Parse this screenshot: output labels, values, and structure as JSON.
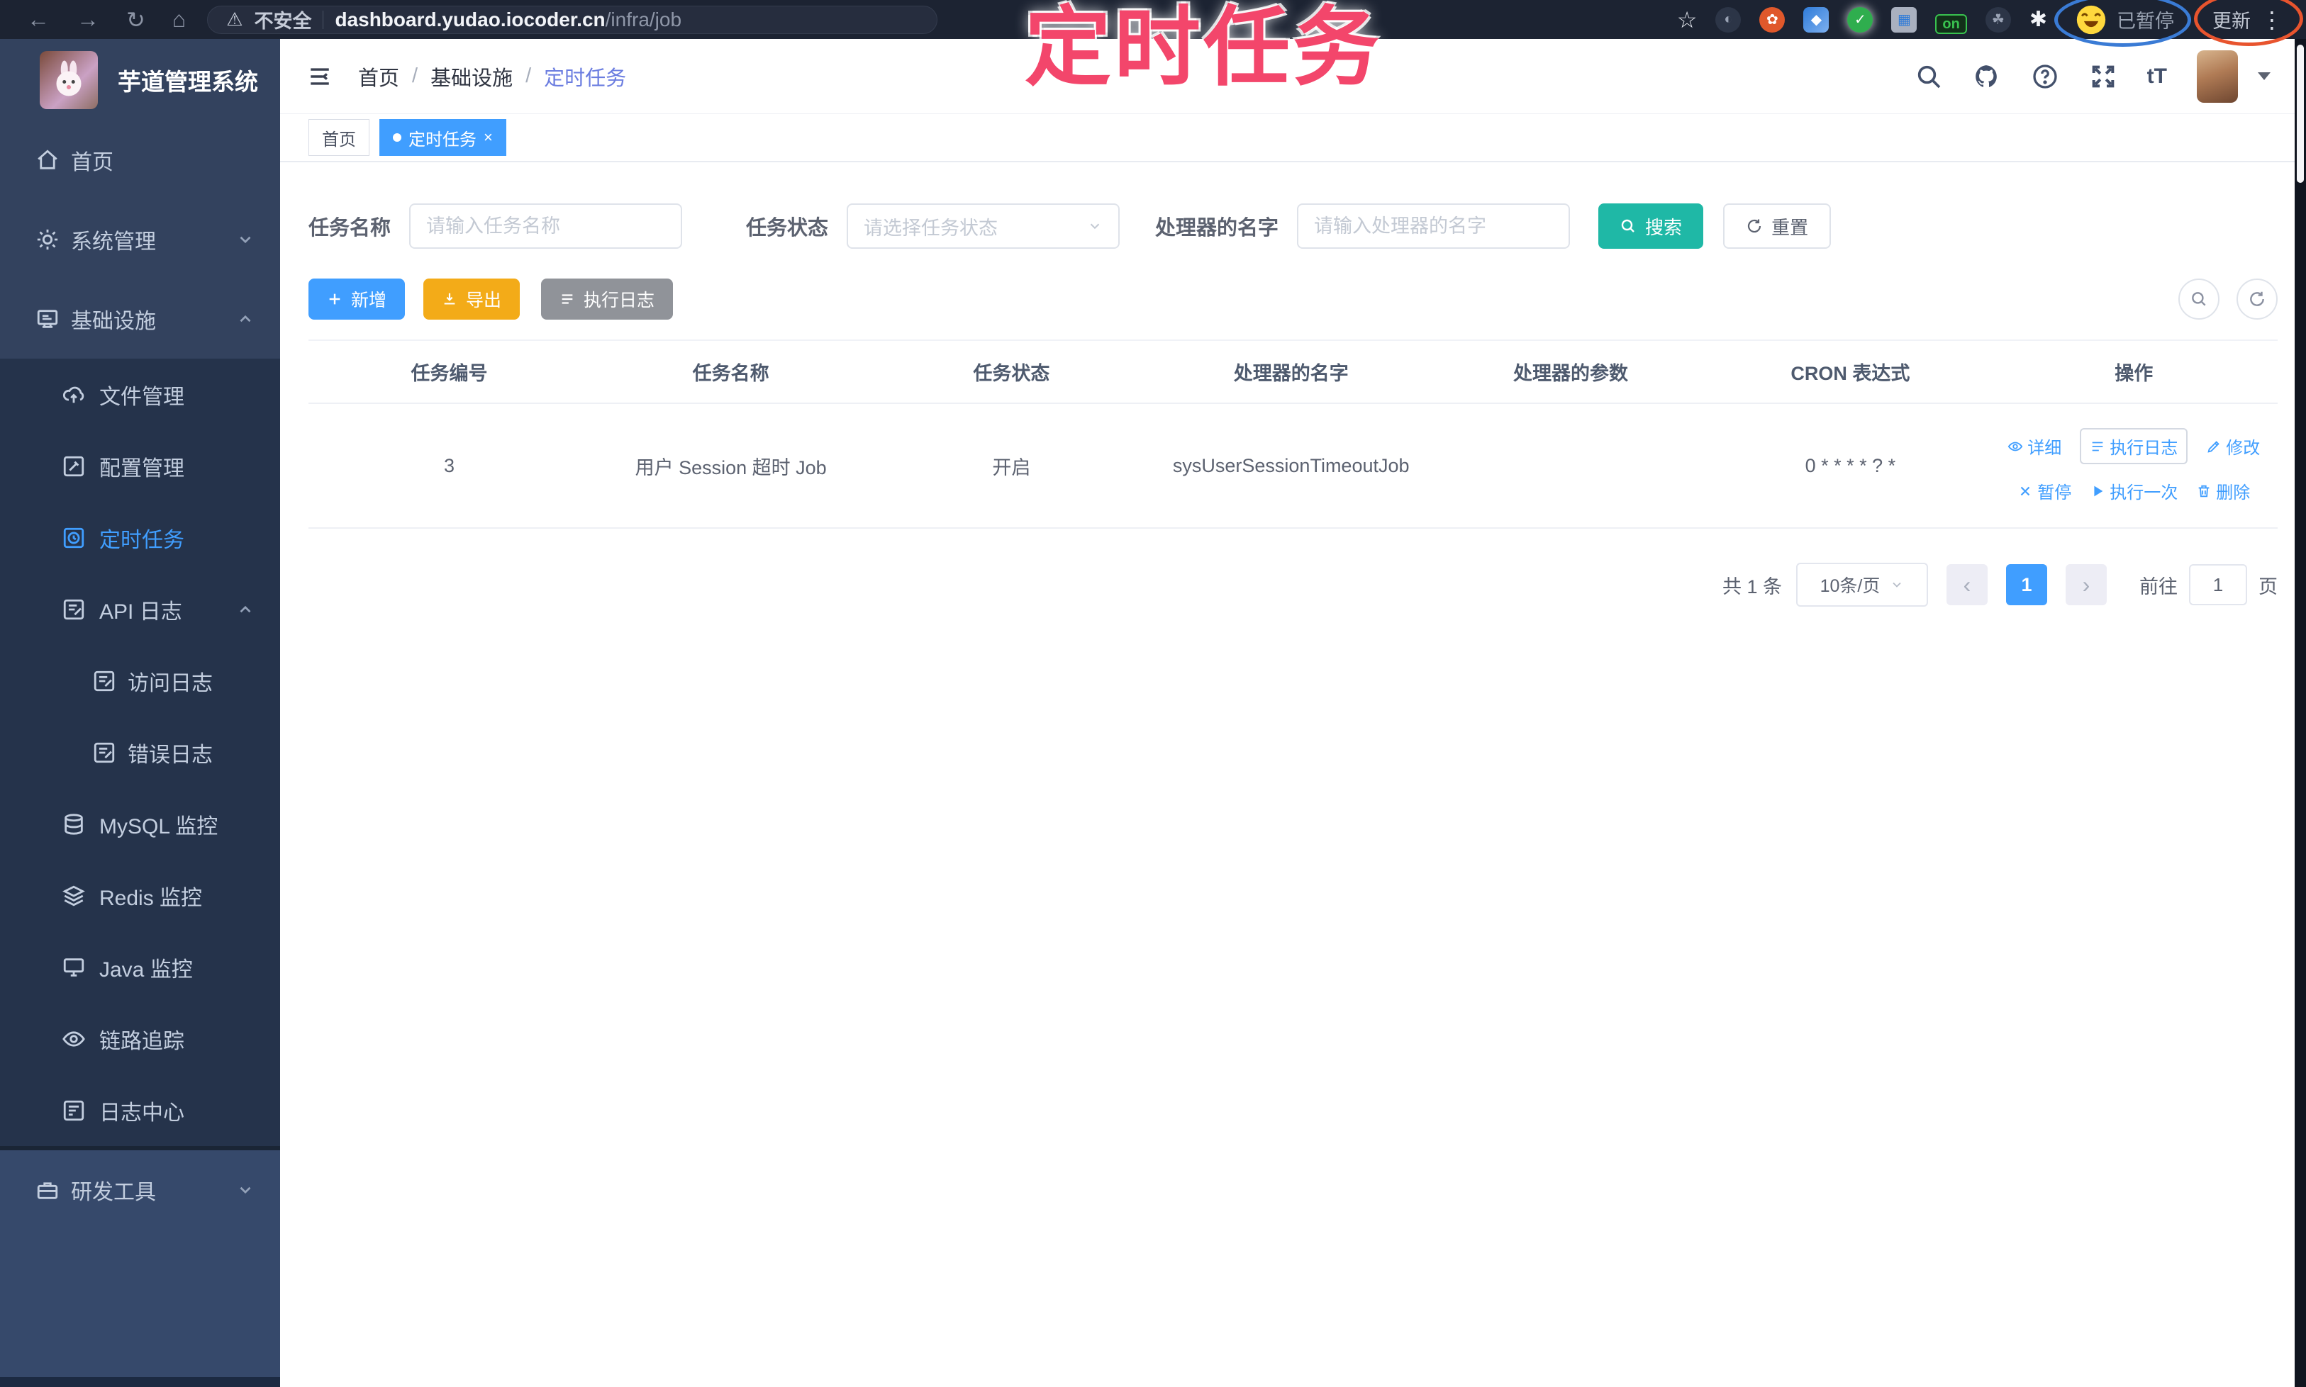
{
  "colors": {
    "accent": "#409eff",
    "search_teal": "#1fb8a6",
    "export_orange": "#f3ab18",
    "info_gray": "#909399",
    "annotation_pink": "#f3466b",
    "sidebar_bg": "#33425e",
    "submenu_bg": "#25334b",
    "tag_active": "#409eff"
  },
  "glyphs": {
    "back": "←",
    "forward": "→",
    "reload": "↻",
    "home": "⌂",
    "warning": "⚠",
    "star": "☆",
    "more": "⋮",
    "font_size": "tT",
    "slash": "/",
    "close": "×",
    "prev": "‹",
    "next": "›",
    "puzzle": "✱",
    "grid": "▦",
    "gear": "✿",
    "gem": "◆",
    "check": "✓",
    "half": "◐"
  },
  "browser": {
    "security": "不安全",
    "url_host": "dashboard.yudao.iocoder.cn",
    "url_path": "/infra/job",
    "ext_badge": "on",
    "paused": "已暂停",
    "update": "更新"
  },
  "annotation": {
    "title": "定时任务"
  },
  "sidebar": {
    "app_title": "芋道管理系统",
    "items": [
      {
        "label": "首页"
      },
      {
        "label": "系统管理"
      },
      {
        "label": "基础设施"
      },
      {
        "label": "文件管理"
      },
      {
        "label": "配置管理"
      },
      {
        "label": "定时任务"
      },
      {
        "label": "API 日志"
      },
      {
        "label": "访问日志"
      },
      {
        "label": "错误日志"
      },
      {
        "label": "MySQL 监控"
      },
      {
        "label": "Redis 监控"
      },
      {
        "label": "Java 监控"
      },
      {
        "label": "链路追踪"
      },
      {
        "label": "日志中心"
      },
      {
        "label": "研发工具"
      }
    ]
  },
  "breadcrumb": [
    "首页",
    "基础设施",
    "定时任务"
  ],
  "tags": {
    "home": "首页",
    "active": "定时任务"
  },
  "filters": {
    "name_label": "任务名称",
    "name_placeholder": "请输入任务名称",
    "status_label": "任务状态",
    "status_placeholder": "请选择任务状态",
    "handler_label": "处理器的名字",
    "handler_placeholder": "请输入处理器的名字",
    "search": "搜索",
    "reset": "重置"
  },
  "toolbar": {
    "add": "新增",
    "export": "导出",
    "exec_log": "执行日志"
  },
  "table": {
    "columns": [
      "任务编号",
      "任务名称",
      "任务状态",
      "处理器的名字",
      "处理器的参数",
      "CRON 表达式",
      "操作"
    ],
    "row": {
      "id": "3",
      "name": "用户 Session 超时 Job",
      "status": "开启",
      "handler": "sysUserSessionTimeoutJob",
      "param": "",
      "cron": "0 * * * * ? *"
    },
    "actions": {
      "detail": "详细",
      "exec_log": "执行日志",
      "edit": "修改",
      "pause": "暂停",
      "run_once": "执行一次",
      "delete": "删除"
    }
  },
  "pagination": {
    "total": "共 1 条",
    "page_size": "10条/页",
    "page": "1",
    "goto": "前往",
    "unit": "页",
    "goto_value": "1"
  }
}
